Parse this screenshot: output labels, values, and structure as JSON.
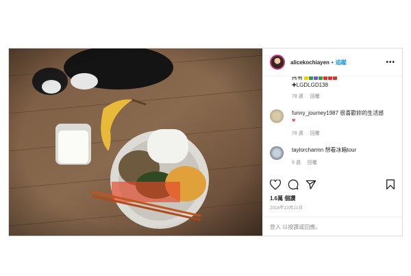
{
  "post": {
    "username": "alicekochiayen",
    "separator": "•",
    "follow_label": "追蹤",
    "more_label": "•••"
  },
  "comments": [
    {
      "text_partial": "拷有",
      "tail": "LGDLGD138",
      "meta_time": "78 週",
      "meta_reply": "回覆"
    },
    {
      "username": "funny_journey1987",
      "text": "很喜歡妳的生活感",
      "meta_time": "78 週",
      "meta_reply": "回覆"
    },
    {
      "username": "taylorcharmn",
      "text": "想看冰箱tour",
      "meta_time": "9 週",
      "meta_reply": "回覆"
    }
  ],
  "likes": "1.6萬 個讚",
  "date": "2018年10月21日",
  "add_comment_placeholder": "登入 以按讚或回應。",
  "colors": {
    "follow_blue": "#0095f6",
    "heart_red": "#ed4956",
    "meta_gray": "#8e8e8e",
    "border": "#dbdbdb"
  }
}
